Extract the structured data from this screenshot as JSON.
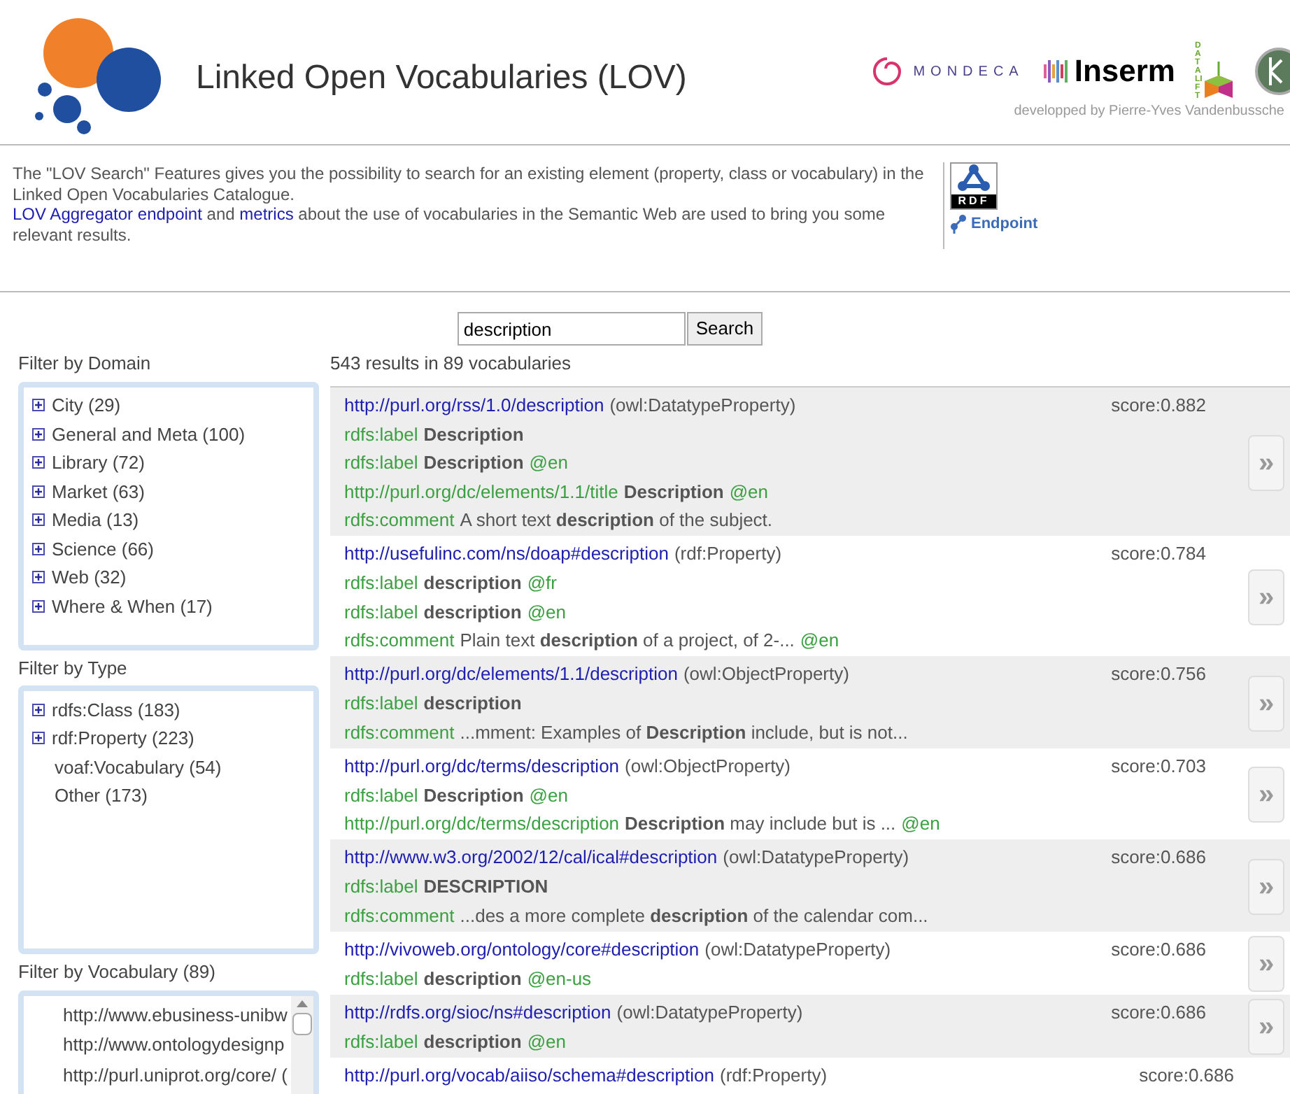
{
  "header": {
    "title": "Linked Open Vocabularies (LOV)",
    "partners": [
      {
        "kind": "mondeca",
        "name": "MONDECA"
      },
      {
        "kind": "inserm",
        "name": "Inserm"
      },
      {
        "kind": "datalift",
        "name": "DATALIFT"
      },
      {
        "kind": "circle"
      }
    ],
    "credit": "developped by Pierre-Yves Vandenbussche"
  },
  "intro": {
    "text": "The \"LOV Search\" Features gives you the possibility to search for an existing element (property, class or vocabulary) in the Linked Open Vocabularies Catalogue.",
    "link1": "LOV Aggregator endpoint",
    "middle": "and",
    "link2": "metrics",
    "rest": "about the use of vocabularies in the Semantic Web are used to bring you some relevant results.",
    "rdf_badge": "RDF",
    "endpoint": "Endpoint"
  },
  "search": {
    "value": "description",
    "button": "Search"
  },
  "filters": [
    {
      "title": "Filter by Domain",
      "kind": "tree",
      "items": [
        {
          "label": "City (29)",
          "expandable": true
        },
        {
          "label": "General and Meta (100)",
          "expandable": true
        },
        {
          "label": "Library (72)",
          "expandable": true
        },
        {
          "label": "Market (63)",
          "expandable": true
        },
        {
          "label": "Media (13)",
          "expandable": true
        },
        {
          "label": "Science (66)",
          "expandable": true
        },
        {
          "label": "Web (32)",
          "expandable": true
        },
        {
          "label": "Where & When (17)",
          "expandable": true
        }
      ]
    },
    {
      "title": "Filter by Type",
      "kind": "tree",
      "items": [
        {
          "label": "rdfs:Class (183)",
          "expandable": true
        },
        {
          "label": "rdf:Property (223)",
          "expandable": true
        },
        {
          "label": "voaf:Vocabulary (54)",
          "expandable": false
        },
        {
          "label": "Other (173)",
          "expandable": false
        }
      ]
    },
    {
      "title": "Filter by Vocabulary (89)",
      "kind": "scroll",
      "items": [
        {
          "label": "http://www.ebusiness-unibw",
          "expandable": false
        },
        {
          "label": "http://www.ontologydesignp",
          "expandable": false
        },
        {
          "label": "http://purl.uniprot.org/core/ (",
          "expandable": false
        }
      ]
    }
  ],
  "results": {
    "summary": "543 results in 89 vocabularies",
    "items": [
      {
        "uri": "http://purl.org/rss/1.0/description",
        "type": "(owl:DatatypeProperty)",
        "score": "score:0.882",
        "more": "»",
        "lines": [
          {
            "property": "rdfs:label",
            "value": "**Description**"
          },
          {
            "property": "rdfs:label",
            "value": "**Description**",
            "lang": "@en"
          },
          {
            "property": "http://purl.org/dc/elements/1.1/title",
            "value": "**Description**",
            "lang": "@en"
          },
          {
            "property": "rdfs:comment",
            "value": "A short text **description** of the subject."
          }
        ]
      },
      {
        "uri": "http://usefulinc.com/ns/doap#description",
        "type": "(rdf:Property)",
        "score": "score:0.784",
        "more": "»",
        "lines": [
          {
            "property": "rdfs:label",
            "value": "**description**",
            "lang": "@fr"
          },
          {
            "property": "rdfs:label",
            "value": "**description**",
            "lang": "@en"
          },
          {
            "property": "rdfs:comment",
            "value": "Plain text **description** of a project, of 2-...",
            "lang": "@en"
          }
        ]
      },
      {
        "uri": "http://purl.org/dc/elements/1.1/description",
        "type": "(owl:ObjectProperty)",
        "score": "score:0.756",
        "more": "»",
        "lines": [
          {
            "property": "rdfs:label",
            "value": "**description**"
          },
          {
            "property": "rdfs:comment",
            "value": "...mment: Examples of **Description** include, but is not..."
          }
        ]
      },
      {
        "uri": "http://purl.org/dc/terms/description",
        "type": "(owl:ObjectProperty)",
        "score": "score:0.703",
        "more": "»",
        "lines": [
          {
            "property": "rdfs:label",
            "value": "**Description**",
            "lang": "@en"
          },
          {
            "property": "http://purl.org/dc/terms/description",
            "value": "**Description** may include but is ...",
            "lang": "@en"
          }
        ]
      },
      {
        "uri": "http://www.w3.org/2002/12/cal/ical#description",
        "type": "(owl:DatatypeProperty)",
        "score": "score:0.686",
        "more": "»",
        "lines": [
          {
            "property": "rdfs:label",
            "value": "**DESCRIPTION**"
          },
          {
            "property": "rdfs:comment",
            "value": "...des a more complete **description** of the calendar com..."
          }
        ]
      },
      {
        "uri": "http://vivoweb.org/ontology/core#description",
        "type": "(owl:DatatypeProperty)",
        "score": "score:0.686",
        "more": "»",
        "lines": [
          {
            "property": "rdfs:label",
            "value": "**description**",
            "lang": "@en-us"
          }
        ]
      },
      {
        "uri": "http://rdfs.org/sioc/ns#description",
        "type": "(owl:DatatypeProperty)",
        "score": "score:0.686",
        "more": "»",
        "lines": [
          {
            "property": "rdfs:label",
            "value": "**description**",
            "lang": "@en"
          }
        ]
      },
      {
        "uri": "http://purl.org/vocab/aiiso/schema#description",
        "type": "(rdf:Property)",
        "score": "score:0.686"
      }
    ]
  }
}
